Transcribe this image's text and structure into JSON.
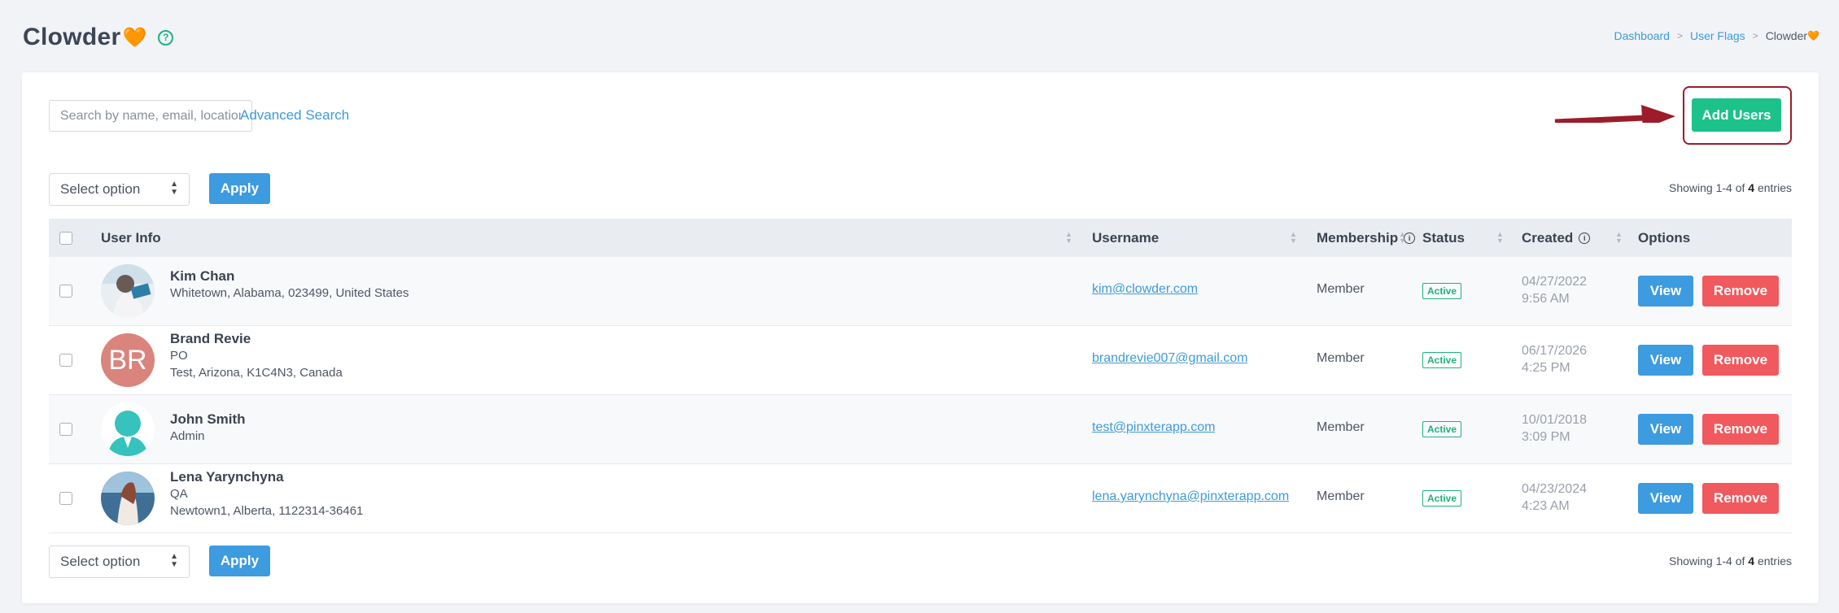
{
  "header": {
    "title": "Clowder",
    "title_emoji": "🧡",
    "help_label": "?"
  },
  "breadcrumb": {
    "items": [
      "Dashboard",
      "User Flags"
    ],
    "current": "Clowder",
    "current_emoji": "🧡",
    "separator": ">"
  },
  "toolbar": {
    "search_placeholder": "Search by name, email, location",
    "advanced_search": "Advanced Search",
    "add_users": "Add Users"
  },
  "bulk_top": {
    "select_value": "Select option",
    "apply": "Apply",
    "showing_prefix": "Showing 1-4 of ",
    "showing_count": "4",
    "showing_suffix": " entries"
  },
  "bulk_bottom": {
    "select_value": "Select option",
    "apply": "Apply",
    "showing_prefix": "Showing 1-4 of ",
    "showing_count": "4",
    "showing_suffix": " entries"
  },
  "columns": {
    "user_info": "User Info",
    "username": "Username",
    "membership": "Membership",
    "status": "Status",
    "created": "Created",
    "options": "Options"
  },
  "rows": [
    {
      "name": "Kim Chan",
      "line1": "Whitetown, Alabama, 023499, United States",
      "line2": "",
      "email": "kim@clowder.com",
      "membership": "Member",
      "status": "Active",
      "date": "04/27/2022",
      "time": "9:56 AM",
      "avatar": "photo-person-laptop",
      "view": "View",
      "remove": "Remove"
    },
    {
      "name": "Brand Revie",
      "line1": "PO",
      "line2": "Test, Arizona, K1C4N3, Canada",
      "email": "brandrevie007@gmail.com",
      "membership": "Member",
      "status": "Active",
      "date": "06/17/2026",
      "time": "4:25 PM",
      "avatar_initials": "BR",
      "view": "View",
      "remove": "Remove"
    },
    {
      "name": "John Smith",
      "line1": "Admin",
      "line2": "",
      "email": "test@pinxterapp.com",
      "membership": "Member",
      "status": "Active",
      "date": "10/01/2018",
      "time": "3:09 PM",
      "avatar": "default-user-silhouette",
      "view": "View",
      "remove": "Remove"
    },
    {
      "name": "Lena Yarynchyna",
      "line1": "QA",
      "line2": "Newtown1, Alberta, 1122314-36461",
      "email": "lena.yarynchyna@pinxterapp.com",
      "membership": "Member",
      "status": "Active",
      "date": "04/23/2024",
      "time": "4:23 AM",
      "avatar": "photo-woman-sea",
      "view": "View",
      "remove": "Remove"
    }
  ],
  "colors": {
    "accent_blue": "#3d9be0",
    "add_green": "#1cc28a",
    "remove_red": "#f0595e",
    "active_green": "#1fb27a",
    "highlight_red": "#9c1c2a"
  }
}
